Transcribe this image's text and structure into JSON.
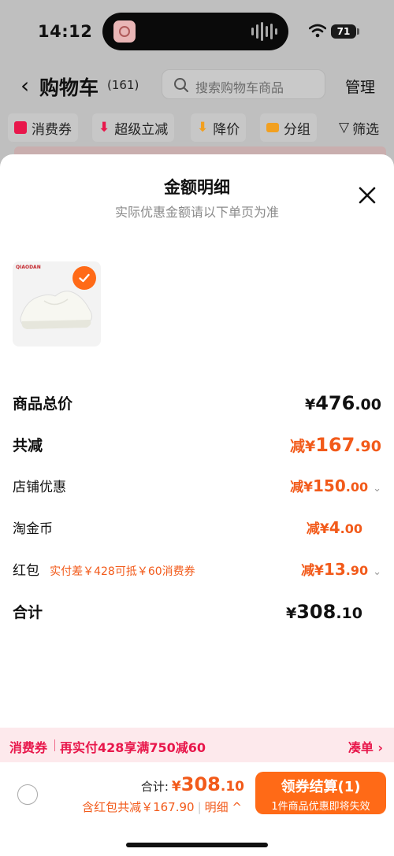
{
  "status": {
    "time": "14:12",
    "battery": "71"
  },
  "nav": {
    "back_icon": "chevron-left-icon",
    "title": "购物车",
    "count": "(161)",
    "search_placeholder": "搜索购物车商品",
    "manage": "管理"
  },
  "chips": [
    {
      "label": "消费券",
      "icon": "coupon-icon",
      "color": "#e8174b"
    },
    {
      "label": "超级立减",
      "icon": "arrow-down-icon",
      "color": "#e8174b"
    },
    {
      "label": "降价",
      "icon": "arrow-down-icon",
      "color": "#f2a020"
    },
    {
      "label": "分组",
      "icon": "folder-icon",
      "color": "#f2a020"
    },
    {
      "label": "筛选",
      "icon": "filter-icon",
      "color": "#222222"
    }
  ],
  "sheet": {
    "title": "金额明细",
    "subtitle": "实际优惠金额请以下单页为准",
    "product_brand": "QIAODAN",
    "rows": {
      "subtotal": {
        "label": "商品总价",
        "yen": "¥",
        "int": "476",
        "dec": ".00"
      },
      "total_reduce": {
        "label": "共减",
        "prefix": "减¥",
        "int": "167",
        "dec": ".90"
      },
      "shop_discount": {
        "label": "店铺优惠",
        "prefix": "减¥",
        "int": "150",
        "dec": ".00"
      },
      "taojinbi": {
        "label": "淘金币",
        "prefix": "减¥",
        "int": "4",
        "dec": ".00"
      },
      "red_packet": {
        "label": "红包",
        "note": "实付差￥428可抵￥60消费券",
        "prefix": "减¥",
        "int": "13",
        "dec": ".90"
      },
      "total": {
        "label": "合计",
        "yen": "¥",
        "int": "308",
        "dec": ".10"
      }
    }
  },
  "coupon_bar": {
    "tag": "消费券",
    "text": "再实付428享满750减60",
    "link": "凑单 ›"
  },
  "checkout": {
    "total_label": "合计:",
    "yen": "¥",
    "int": "308",
    "dec": ".10",
    "discount_text": "含红包共减￥167.90",
    "detail": "明细 ^",
    "button_main": "领券结算(1)",
    "button_sub": "1件商品优惠即将失效"
  },
  "colors": {
    "accent": "#ff6a17",
    "price_orange": "#f25a1a",
    "coupon_red": "#e8174b"
  }
}
